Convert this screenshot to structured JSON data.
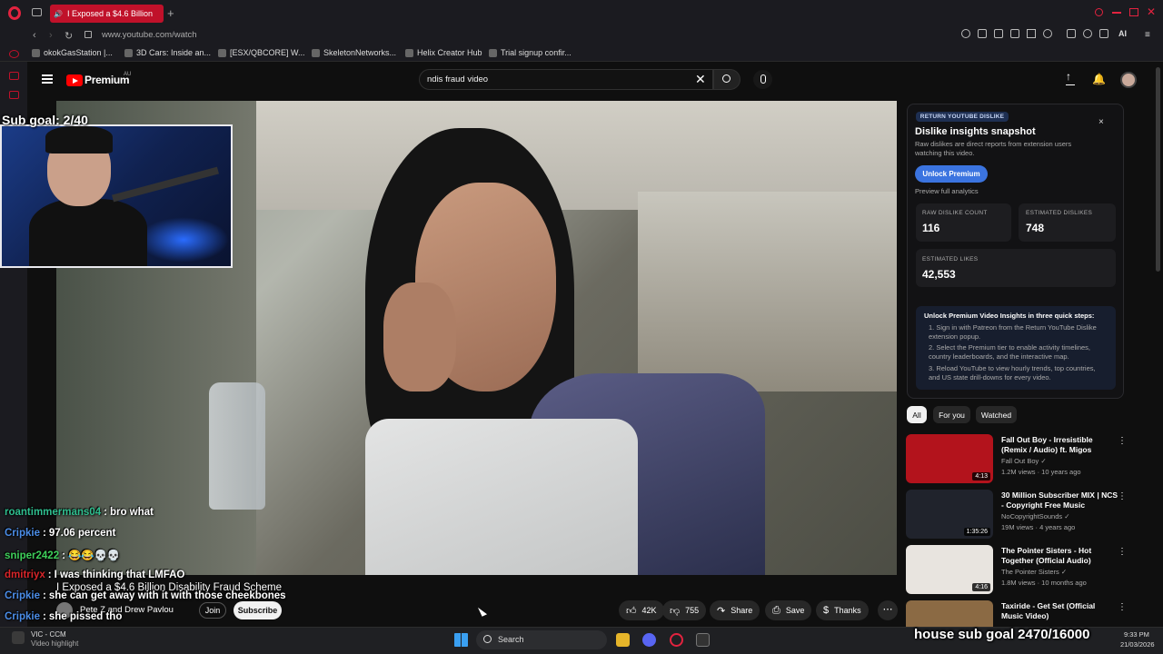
{
  "browser": {
    "tab_title": "I Exposed a $4.6 Billion",
    "url": "www.youtube.com/watch",
    "ai_label": "AI",
    "bookmarks": [
      "okokGasStation |...",
      "3D Cars: Inside an...",
      "[ESX/QBCORE] W...",
      "SkeletonNetworks...",
      "Helix Creator Hub",
      "Trial signup confir..."
    ]
  },
  "youtube": {
    "brand": "Premium",
    "region": "AU",
    "search_value": "ndis fraud video"
  },
  "stream_overlay": {
    "sub_goal": "Sub goal: 2/40",
    "house_goal": "house sub goal 2470/16000"
  },
  "chat": [
    {
      "user": "roantimmermans04",
      "sep": ":",
      "msg": "bro what",
      "color": "#2fbf8f"
    },
    {
      "user": "Cripkie",
      "sep": ":",
      "msg": "97.06 percent",
      "color": "#4b8de8"
    },
    {
      "user": "sniper2422",
      "sep": ":",
      "msg": "😂😂💀💀",
      "color": "#3ecf5a"
    },
    {
      "user": "dmitriyx",
      "sep": ":",
      "msg": "I was thinking that LMFAO",
      "color": "#d8252a"
    },
    {
      "user": "Cripkie",
      "sep": ":",
      "msg": "she can get away with it with those cheekbones",
      "color": "#4b8de8"
    },
    {
      "user": "Cripkie",
      "sep": ":",
      "msg": "she pissed tho",
      "color": "#4b8de8"
    }
  ],
  "video": {
    "title": "I Exposed a $4.6 Billion Disability Fraud Scheme",
    "channel": "Pete Z and Drew Pavlou",
    "join_label": "Join",
    "subscribe_label": "Subscribe",
    "likes": "42K",
    "dislikes": "755",
    "share_label": "Share",
    "save_label": "Save",
    "thanks_label": "Thanks"
  },
  "rtd_panel": {
    "badge": "RETURN YOUTUBE DISLIKE",
    "title": "Dislike insights snapshot",
    "description": "Raw dislikes are direct reports from extension users watching this video.",
    "unlock_label": "Unlock Premium",
    "preview_label": "Preview full analytics",
    "stats": [
      {
        "label": "RAW DISLIKE COUNT",
        "value": "116"
      },
      {
        "label": "ESTIMATED DISLIKES",
        "value": "748"
      },
      {
        "label": "ESTIMATED LIKES",
        "value": "42,553"
      }
    ],
    "steps_title": "Unlock Premium Video Insights in three quick steps:",
    "steps": [
      "1.  Sign in with Patreon from the Return YouTube Dislike extension popup.",
      "2.  Select the Premium tier to enable activity timelines, country leaderboards, and the interactive map.",
      "3.  Reload YouTube to view hourly trends, top countries, and US state drill-downs for every video."
    ]
  },
  "chips": [
    "All",
    "For you",
    "Watched"
  ],
  "recommended": [
    {
      "title": "Fall Out Boy - Irresistible (Remix / Audio) ft. Migos",
      "channel": "Fall Out Boy ✓",
      "meta": "1.2M views · 10 years ago",
      "duration": "4:13",
      "color": "#b3131c"
    },
    {
      "title": "30 Million Subscriber MIX | NCS - Copyright Free Music",
      "channel": "NoCopyrightSounds ✓",
      "meta": "19M views · 4 years ago",
      "duration": "1:35:26",
      "color": "#20232c"
    },
    {
      "title": "The Pointer Sisters - Hot Together (Official Audio)",
      "channel": "The Pointer Sisters ✓",
      "meta": "1.8M views · 10 months ago",
      "duration": "4:16",
      "color": "#e8e4df"
    },
    {
      "title": "Taxiride - Get Set (Official Music Video)",
      "channel": "",
      "meta": "",
      "duration": "",
      "color": "#8b6a44"
    }
  ],
  "taskbar": {
    "app_name": "VIC - CCM",
    "app_sub": "Video highlight",
    "search_label": "Search",
    "time": "9:33 PM",
    "date": "21/03/2026"
  }
}
